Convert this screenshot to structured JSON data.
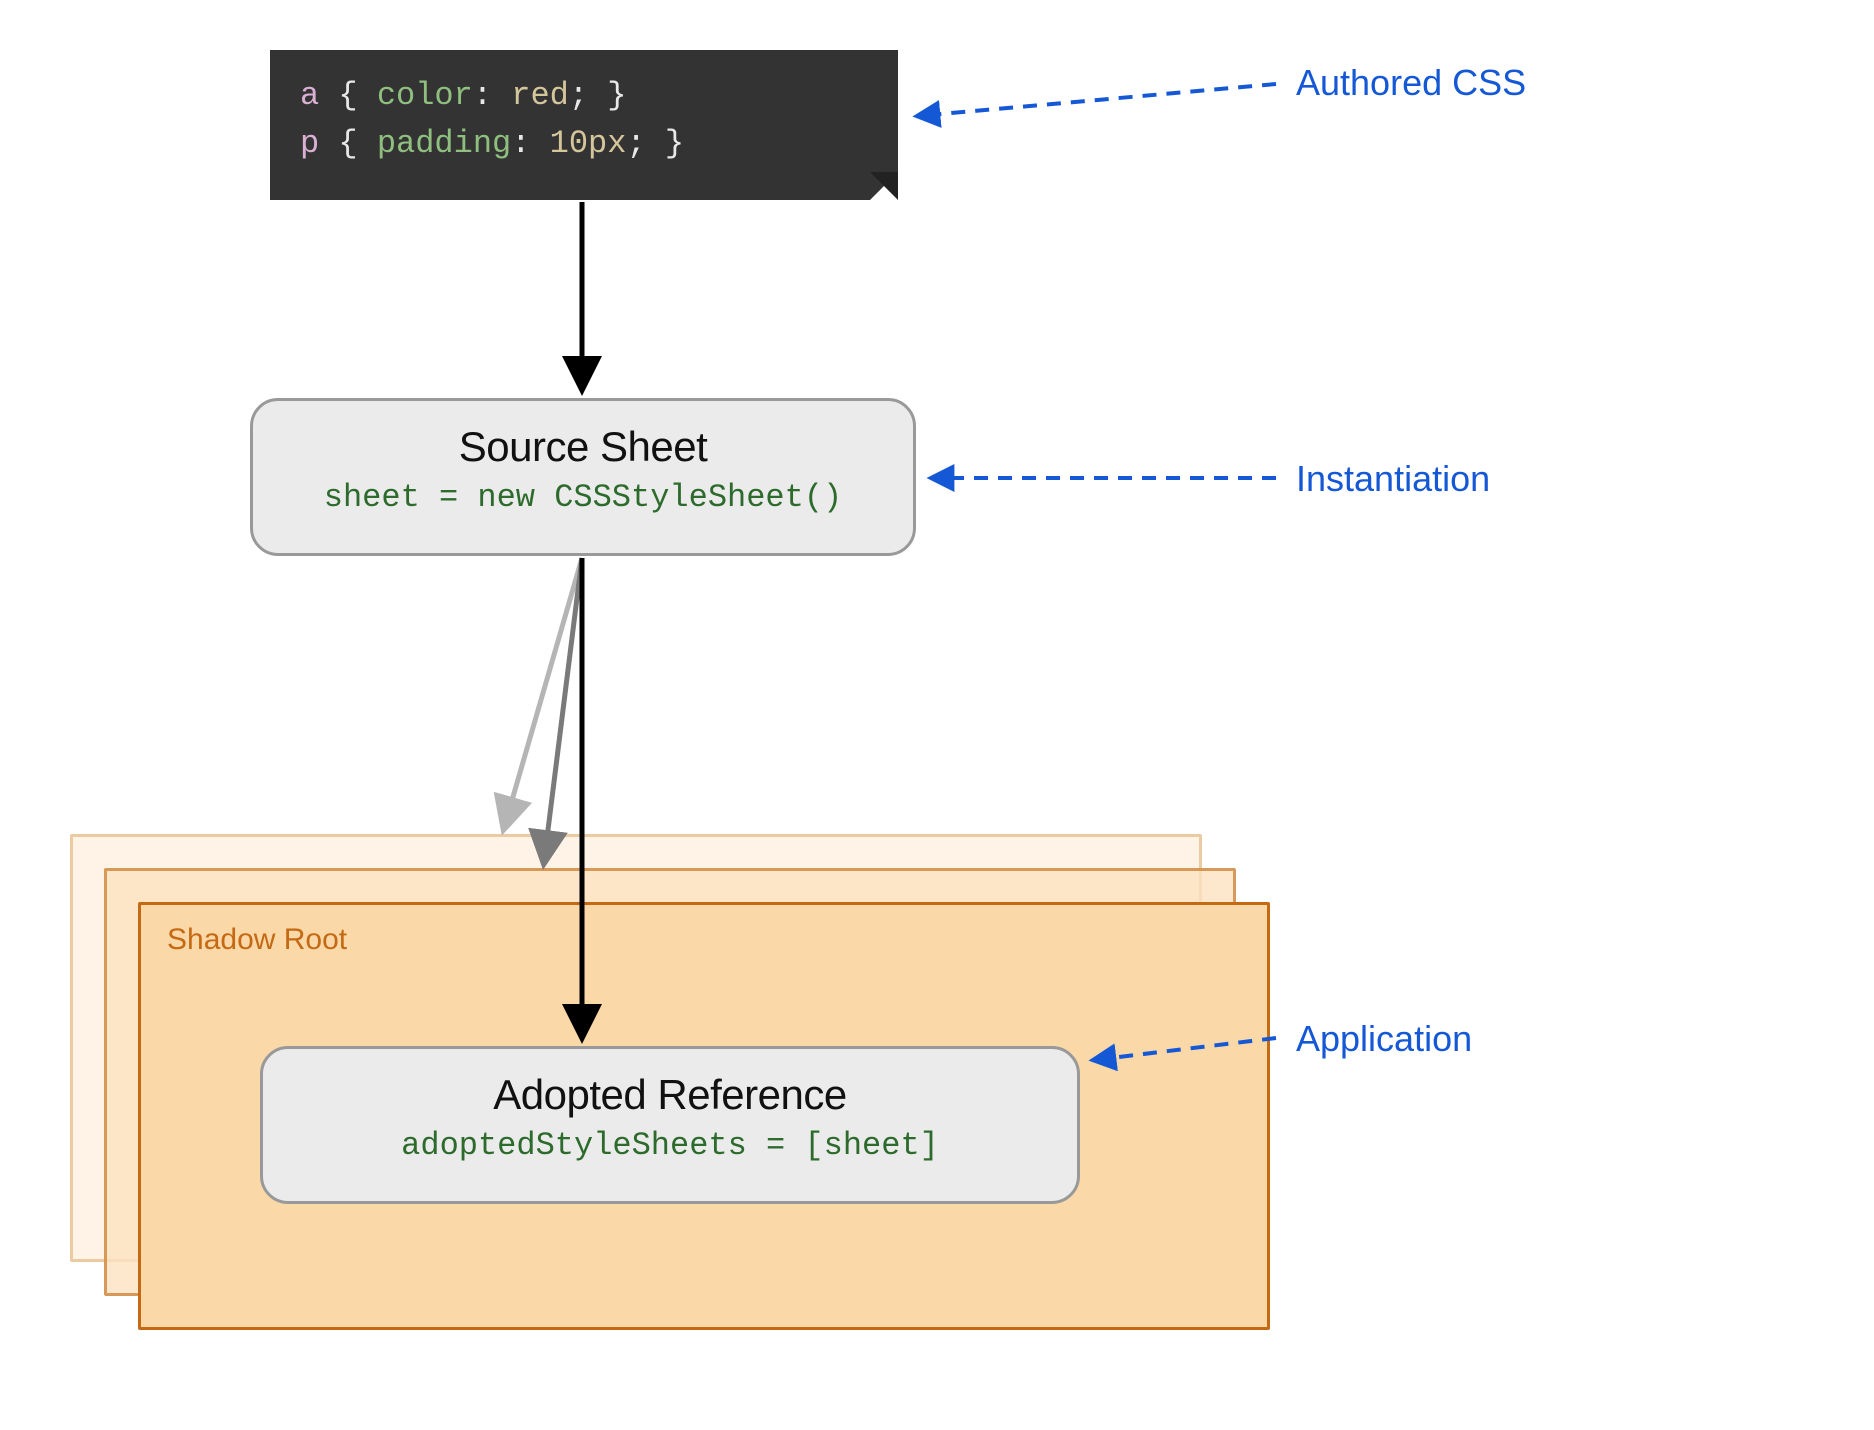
{
  "code": {
    "line1": {
      "selector": "a",
      "brace_open": "{",
      "prop": "color",
      "colon": ":",
      "value": "red",
      "semi": ";",
      "brace_close": "}"
    },
    "line2": {
      "selector": "p",
      "brace_open": "{",
      "prop": "padding",
      "colon": ":",
      "value": "10px",
      "semi": ";",
      "brace_close": "}"
    }
  },
  "source_sheet": {
    "title": "Source Sheet",
    "code": "sheet = new CSSStyleSheet()"
  },
  "shadow_root": {
    "label": "Shadow Root"
  },
  "adopted_ref": {
    "title": "Adopted Reference",
    "code": "adoptedStyleSheets = [sheet]"
  },
  "annotations": {
    "authored": "Authored CSS",
    "instantiation": "Instantiation",
    "application": "Application"
  }
}
